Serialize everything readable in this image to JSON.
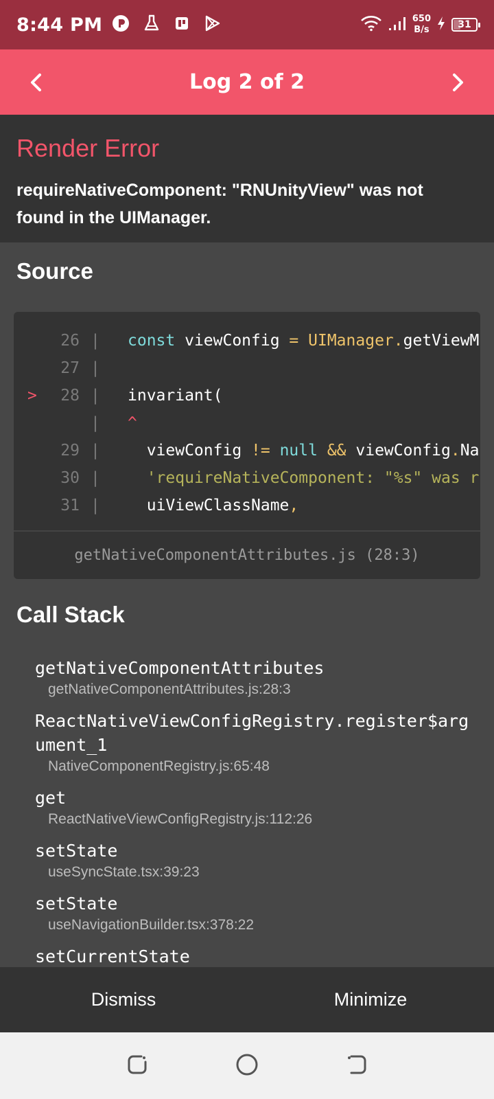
{
  "status_bar": {
    "time": "8:44 PM",
    "net_speed_value": "650",
    "net_speed_unit": "B/s",
    "battery": "31",
    "battery_level_percent": 31,
    "notification_icons": [
      "app-p-icon",
      "flask-icon",
      "pdf-icon",
      "play-store-icon"
    ]
  },
  "header": {
    "title": "Log 2 of 2",
    "accent_color": "#f2556a"
  },
  "error": {
    "title": "Render Error",
    "message": "requireNativeComponent: \"RNUnityView\" was not found in the UIManager."
  },
  "source": {
    "heading": "Source",
    "lines": [
      {
        "marker": "",
        "num": "26",
        "text": "const viewConfig = UIManager.getViewM"
      },
      {
        "marker": "",
        "num": "27",
        "text": ""
      },
      {
        "marker": ">",
        "num": "28",
        "text": "invariant("
      },
      {
        "marker": "",
        "num": "",
        "text": "^"
      },
      {
        "marker": "",
        "num": "29",
        "text": "  viewConfig != null && viewConfig.Na"
      },
      {
        "marker": "",
        "num": "30",
        "text": "  'requireNativeComponent: \"%s\" was r"
      },
      {
        "marker": "",
        "num": "31",
        "text": "  uiViewClassName,"
      }
    ],
    "file": "getNativeComponentAttributes.js (28:3)"
  },
  "call_stack": {
    "heading": "Call Stack",
    "frames": [
      {
        "name": "getNativeComponentAttributes",
        "location": "getNativeComponentAttributes.js:28:3"
      },
      {
        "name": "ReactNativeViewConfigRegistry.register$argument_1",
        "location": "NativeComponentRegistry.js:65:48"
      },
      {
        "name": "get",
        "location": "ReactNativeViewConfigRegistry.js:112:26"
      },
      {
        "name": "setState",
        "location": "useSyncState.tsx:39:23"
      },
      {
        "name": "setState",
        "location": "useNavigationBuilder.tsx:378:22"
      },
      {
        "name": "setCurrentState",
        "location": ""
      }
    ]
  },
  "buttons": {
    "dismiss": "Dismiss",
    "minimize": "Minimize"
  }
}
